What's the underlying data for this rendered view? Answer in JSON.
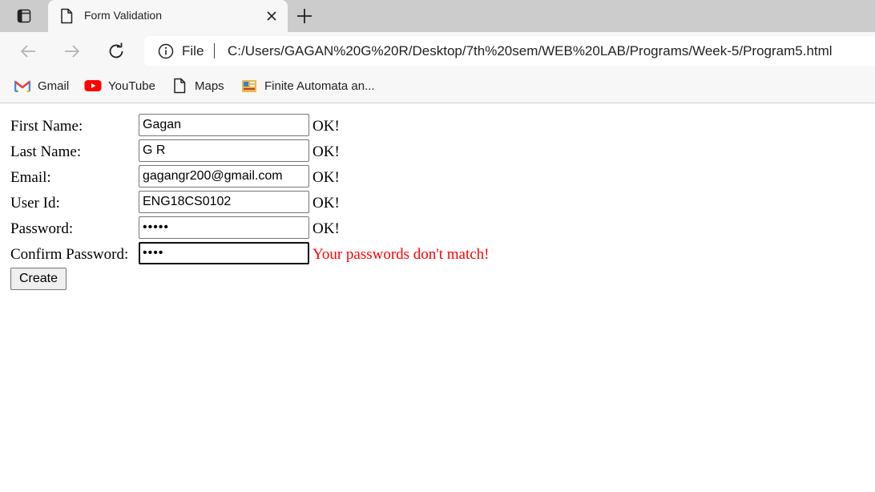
{
  "browser": {
    "tab": {
      "title": "Form Validation",
      "close_symbol": "✕"
    },
    "new_tab_symbol": "+",
    "address": {
      "scheme_label": "File",
      "url": "C:/Users/GAGAN%20G%20R/Desktop/7th%20sem/WEB%20LAB/Programs/Week-5/Program5.html"
    },
    "bookmarks": [
      {
        "label": "Gmail",
        "icon": "gmail-icon"
      },
      {
        "label": "YouTube",
        "icon": "youtube-icon"
      },
      {
        "label": "Maps",
        "icon": "page-icon"
      },
      {
        "label": "Finite Automata an...",
        "icon": "bookmark-favicon"
      }
    ]
  },
  "form": {
    "fields": [
      {
        "label": "First Name:",
        "value": "Gagan",
        "status": "OK!"
      },
      {
        "label": "Last Name:",
        "value": "G R",
        "status": "OK!"
      },
      {
        "label": "Email:",
        "value": "gagangr200@gmail.com",
        "status": "OK!"
      },
      {
        "label": "User Id:",
        "value": "ENG18CS0102",
        "status": "OK!"
      },
      {
        "label": "Password:",
        "value": "•••••",
        "status": "OK!"
      },
      {
        "label": "Confirm Password:",
        "value": "••••",
        "status": "Your passwords don't match!"
      }
    ],
    "submit_label": "Create"
  },
  "colors": {
    "error": "#ff0000",
    "tabstrip": "#cccccc",
    "chrome": "#f7f7f7",
    "youtube_red": "#ff0000"
  }
}
